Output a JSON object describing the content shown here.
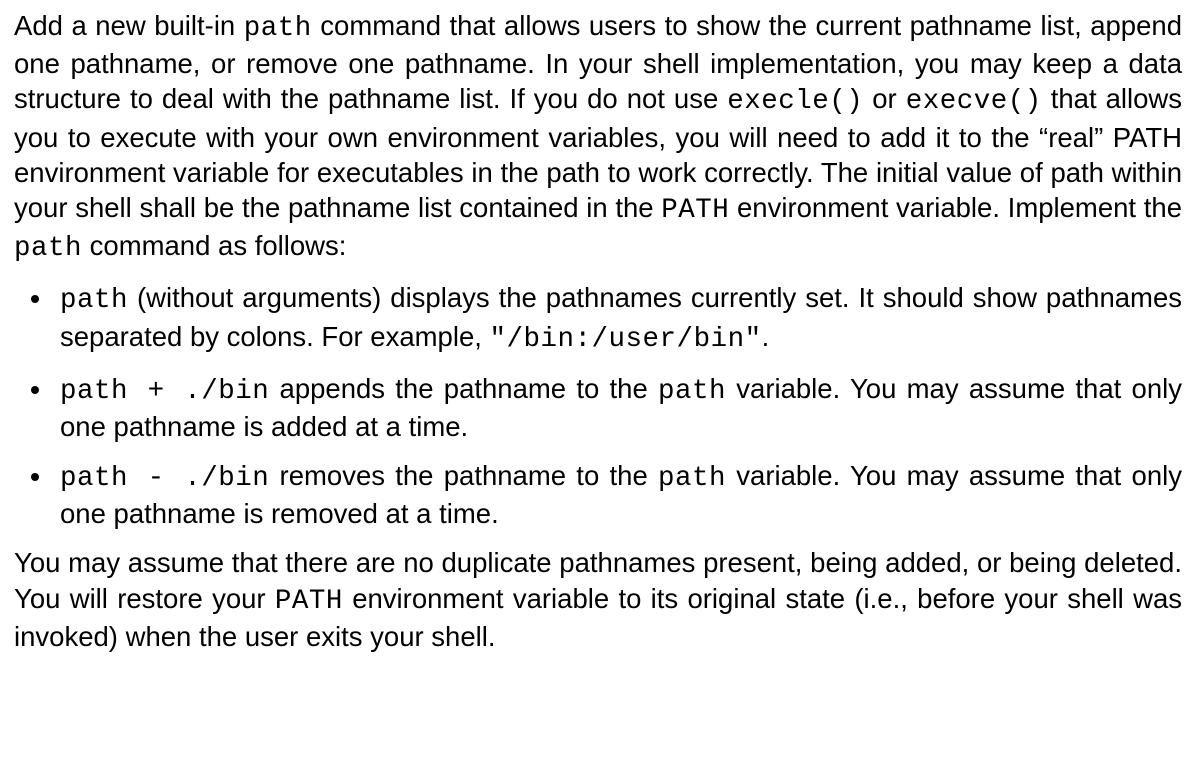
{
  "intro": {
    "t0": "Add a new built-in ",
    "c0": "path",
    "t1": " command that allows users to show the current pathname list, append one pathname, or remove one pathname. In your shell implementation, you may keep a data structure to deal with the pathname list. If you do not use ",
    "c1": "execle()",
    "t2": " or ",
    "c2": "execve()",
    "t3": " that allows you to execute with your own environment variables, you will need to add it to the “real” PATH environment variable for executables in the path to work correctly. The initial value of path within your shell shall be the pathname list contained in  the ",
    "c3": "PATH",
    "t4": " environment variable. Implement the ",
    "c4": "path",
    "t5": " command as follows:"
  },
  "b1": {
    "c0": "path",
    "t0": " (without arguments) displays the pathnames currently set. It should show pathnames separated by colons. For example, ",
    "c1": "\"/bin:/user/bin\"",
    "t1": "."
  },
  "b2": {
    "c0": "path + ./bin",
    "t0": " appends the pathname to the ",
    "c1": "path",
    "t1": " variable. You may assume that only one pathname is added at a time."
  },
  "b3": {
    "c0": "path - ./bin",
    "t0": " removes the pathname to the ",
    "c1": "path",
    "t1": " variable. You may assume that only one pathname is removed at a time."
  },
  "outro": {
    "t0": "You may assume that there are no duplicate pathnames present,  being added, or being deleted. You will restore your ",
    "c0": "PATH",
    "t1": " environment variable to its original state (i.e., before your shell was invoked) when the user exits your shell."
  }
}
